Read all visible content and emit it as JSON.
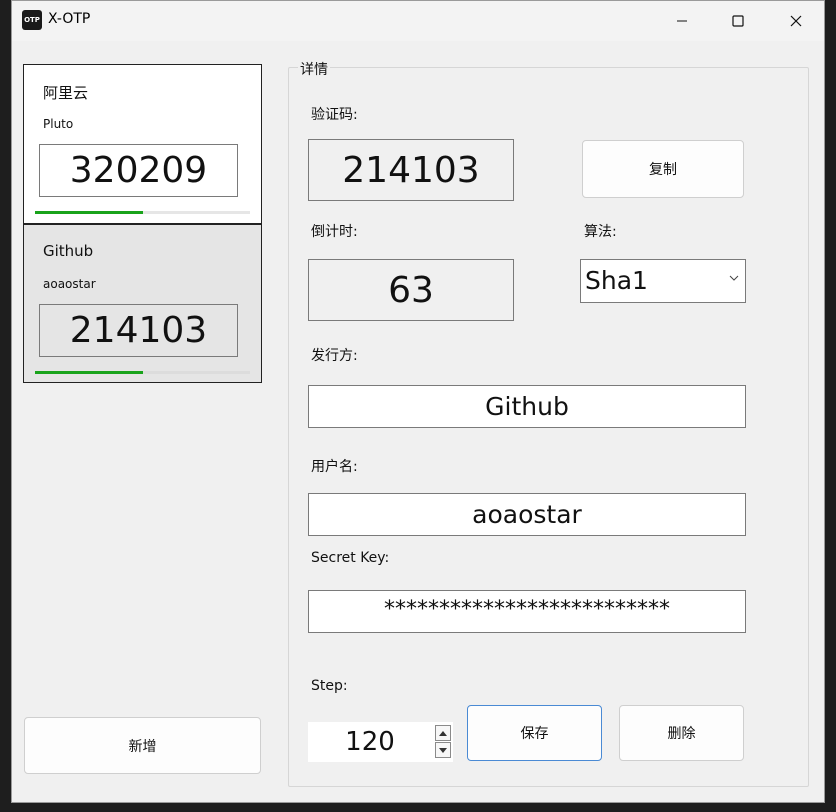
{
  "window": {
    "title": "X-OTP",
    "icon_text": "OTP"
  },
  "accounts": [
    {
      "issuer": "阿里云",
      "user": "Pluto",
      "code": "320209",
      "progress": 0.5
    },
    {
      "issuer": "Github",
      "user": "aoaostar",
      "code": "214103",
      "progress": 0.5
    }
  ],
  "add_button": "新增",
  "details": {
    "group_title": "详情",
    "code_label": "验证码:",
    "code": "214103",
    "copy_button": "复制",
    "countdown_label": "倒计时:",
    "countdown": "63",
    "algorithm_label": "算法:",
    "algorithm": "Sha1",
    "issuer_label": "发行方:",
    "issuer": "Github",
    "username_label": "用户名:",
    "username": "aoaostar",
    "secret_label": "Secret Key:",
    "secret": "**************************",
    "step_label": "Step:",
    "step": "120",
    "save_button": "保存",
    "delete_button": "删除"
  },
  "colors": {
    "progress": "#19a31b",
    "save_border": "#4a8ad4"
  }
}
